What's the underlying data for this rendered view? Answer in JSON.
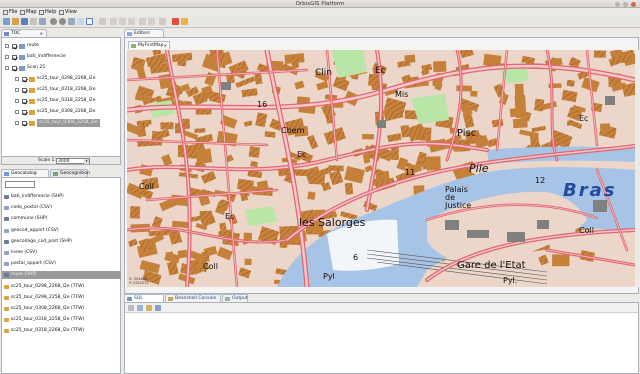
{
  "window": {
    "title": "OrbisGIS Platform"
  },
  "menu": [
    {
      "label": "File"
    },
    {
      "label": "Map"
    },
    {
      "label": "Help"
    },
    {
      "label": "View"
    }
  ],
  "toc": {
    "tab_label": "TOC",
    "layers": [
      {
        "label": "route",
        "checked": true,
        "indent": 0
      },
      {
        "label": "bati_indifferencie",
        "checked": true,
        "indent": 0
      },
      {
        "label": "Scan 25",
        "checked": true,
        "indent": 0
      },
      {
        "label": "sc25_tour_0298_2268_l2e",
        "checked": true,
        "indent": 1
      },
      {
        "label": "sc25_tour_0318_2268_l2e",
        "checked": true,
        "indent": 1
      },
      {
        "label": "sc25_tour_0318_2258_l2e",
        "checked": true,
        "indent": 1
      },
      {
        "label": "sc25_tour_0308_2268_l2e",
        "checked": true,
        "indent": 1
      },
      {
        "label": "sc25_tour_0308_2258_l2e",
        "checked": true,
        "indent": 1,
        "selected": true
      }
    ],
    "scale_label": "Scale 1:",
    "scale_value": "3000"
  },
  "geocatalog": {
    "tab_label": "Geocatalog",
    "tab2_label": "Geocognition",
    "search_value": "",
    "items": [
      {
        "label": "bati_indifferencie (SHP)",
        "icon_color": "#6b7a9c"
      },
      {
        "label": "code_postal (CSV)",
        "icon_color": "#8fa3c9"
      },
      {
        "label": "commune (SHP)",
        "icon_color": "#6b7a9c"
      },
      {
        "label": "geocod_appart (CSV)",
        "icon_color": "#8fa3c9"
      },
      {
        "label": "geocodage_cod_post (SHP)",
        "icon_color": "#6b7a9c"
      },
      {
        "label": "insee (CSV)",
        "icon_color": "#8fa3c9"
      },
      {
        "label": "postal_appart (CSV)",
        "icon_color": "#8fa3c9"
      },
      {
        "label": "route (SHP)",
        "icon_color": "#6b7a9c",
        "selected": true
      },
      {
        "label": "sc25_tour_0298_2268_l2e (TFW)",
        "icon_color": "#d9a441"
      },
      {
        "label": "sc25_tour_0298_2258_l2e (TFW)",
        "icon_color": "#d9a441"
      },
      {
        "label": "sc25_tour_0308_2268_l2e (TFW)",
        "icon_color": "#d9a441"
      },
      {
        "label": "sc25_tour_0318_2258_l2e (TFW)",
        "icon_color": "#d9a441"
      },
      {
        "label": "sc25_tour_0318_2268_l2e (TFW)",
        "icon_color": "#d9a441"
      }
    ]
  },
  "editors": {
    "tab_label": "Editors",
    "map_tab_label": "MyFirstMap"
  },
  "map": {
    "labels": [
      {
        "text": "Clin"
      },
      {
        "text": "Ec"
      },
      {
        "text": "Mis"
      },
      {
        "text": "16"
      },
      {
        "text": "Cbem"
      },
      {
        "text": "Pisc"
      },
      {
        "text": "Pile"
      },
      {
        "text": "Bras"
      },
      {
        "text": "11"
      },
      {
        "text": "12"
      },
      {
        "text": "Ec"
      },
      {
        "text": "Coll"
      },
      {
        "text": "les Salorges"
      },
      {
        "text": "Palais de Justice"
      },
      {
        "text": "Coll"
      },
      {
        "text": "6"
      },
      {
        "text": "Gare de l'Etat"
      },
      {
        "text": "Pyl"
      },
      {
        "text": "Pyl."
      },
      {
        "text": "Ec"
      },
      {
        "text": "Coll"
      },
      {
        "text": "Ec"
      }
    ],
    "coord_x": "X: 304446",
    "coord_y": "Y: 2252272"
  },
  "bottom_tabs": [
    {
      "label": "SQL Console"
    },
    {
      "label": "Beanshell Console"
    },
    {
      "label": "Output"
    }
  ],
  "colors": {
    "road": "#e2656f",
    "water": "#a7c3e5",
    "park": "#b9e6a6",
    "building": "#c5813a",
    "selection": "#9a9a9a"
  }
}
